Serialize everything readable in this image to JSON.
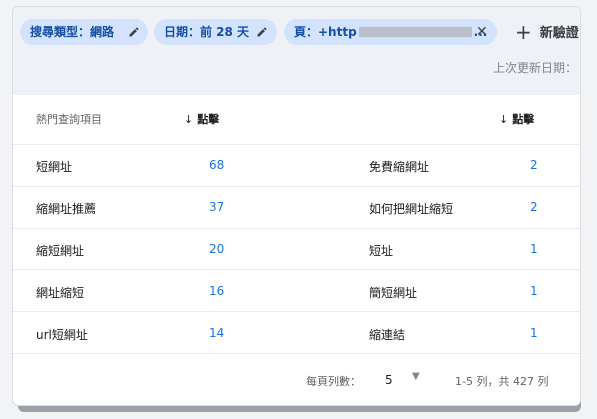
{
  "filters": [
    {
      "label": "搜尋類型：網路"
    },
    {
      "label": "日期：前 28 天"
    },
    {
      "label_prefix": "頁：+http",
      "label_suffix": "..."
    }
  ],
  "add_button": {
    "label": "新驗證"
  },
  "last_updated": {
    "label": "上次更新日期："
  },
  "tables": [
    {
      "header_query": "熱門查詢項目",
      "header_clicks": "點擊",
      "rows": [
        {
          "query": "短網址",
          "clicks": "68"
        },
        {
          "query": "縮網址推薦",
          "clicks": "37"
        },
        {
          "query": "縮短網址",
          "clicks": "20"
        },
        {
          "query": "網址縮短",
          "clicks": "16"
        },
        {
          "query": "url短網址",
          "clicks": "14"
        }
      ]
    },
    {
      "header_query": "",
      "header_clicks": "點擊",
      "rows": [
        {
          "query": "免費縮網址",
          "clicks": "2"
        },
        {
          "query": "如何把網址縮短",
          "clicks": "2"
        },
        {
          "query": "短址",
          "clicks": "1"
        },
        {
          "query": "簡短網址",
          "clicks": "1"
        },
        {
          "query": "縮連結",
          "clicks": "1"
        }
      ]
    }
  ],
  "pagination": {
    "rows_per_page_label": "每頁列數：",
    "rows_per_page_value": "5",
    "range_label": "1-5 列，共 427 列"
  },
  "colors": {
    "chip_bg": "#d3e3fd",
    "chip_text": "#174ea6",
    "link": "#1a73e8"
  }
}
